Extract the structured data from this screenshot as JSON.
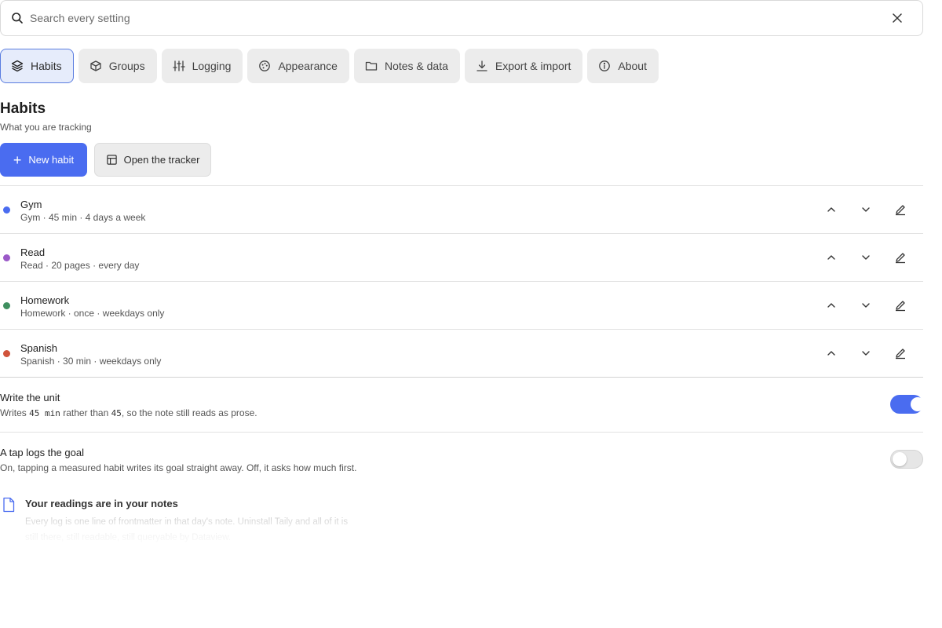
{
  "search": {
    "placeholder": "Search every setting",
    "value": "",
    "icon": "search-icon",
    "clear_icon": "close-icon"
  },
  "tabs": [
    {
      "label": "Habits",
      "icon": "layers-icon",
      "active": true
    },
    {
      "label": "Groups",
      "icon": "box-icon",
      "active": false
    },
    {
      "label": "Logging",
      "icon": "sliders-icon",
      "active": false
    },
    {
      "label": "Appearance",
      "icon": "palette-icon",
      "active": false
    },
    {
      "label": "Notes & data",
      "icon": "folder-icon",
      "active": false
    },
    {
      "label": "Export & import",
      "icon": "download-icon",
      "active": false
    },
    {
      "label": "About",
      "icon": "info-icon",
      "active": false
    }
  ],
  "section": {
    "title": "Habits",
    "subtitle": "What you are tracking",
    "new_habit_label": "New habit",
    "open_tracker_label": "Open the tracker"
  },
  "habits": [
    {
      "name": "Gym",
      "desc": "Gym · 45 min · 4 days a week",
      "color": "#4a6cf0"
    },
    {
      "name": "Read",
      "desc": "Read · 20 pages · every day",
      "color": "#9b59c8"
    },
    {
      "name": "Homework",
      "desc": "Homework · once · weekdays only",
      "color": "#3f8f5f"
    },
    {
      "name": "Spanish",
      "desc": "Spanish · 30 min · weekdays only",
      "color": "#d0533b"
    }
  ],
  "settings": {
    "write_unit": {
      "title": "Write the unit",
      "desc_prefix": "Writes ",
      "code_a": "45 min",
      "desc_middle": " rather than ",
      "code_b": "45",
      "desc_suffix": ", so the note still reads as prose.",
      "enabled": true
    },
    "tap_logs_goal": {
      "title": "A tap logs the goal",
      "desc": "On, tapping a measured habit writes its goal straight away. Off, it asks how much first.",
      "enabled": false
    }
  },
  "note": {
    "title": "Your readings are in your notes",
    "body": "Every log is one line of frontmatter in that day's note. Uninstall Taily and all of it is still there, still readable, still queryable by Dataview.",
    "icon": "file-icon"
  },
  "colors": {
    "accent": "#4a6cf0"
  }
}
